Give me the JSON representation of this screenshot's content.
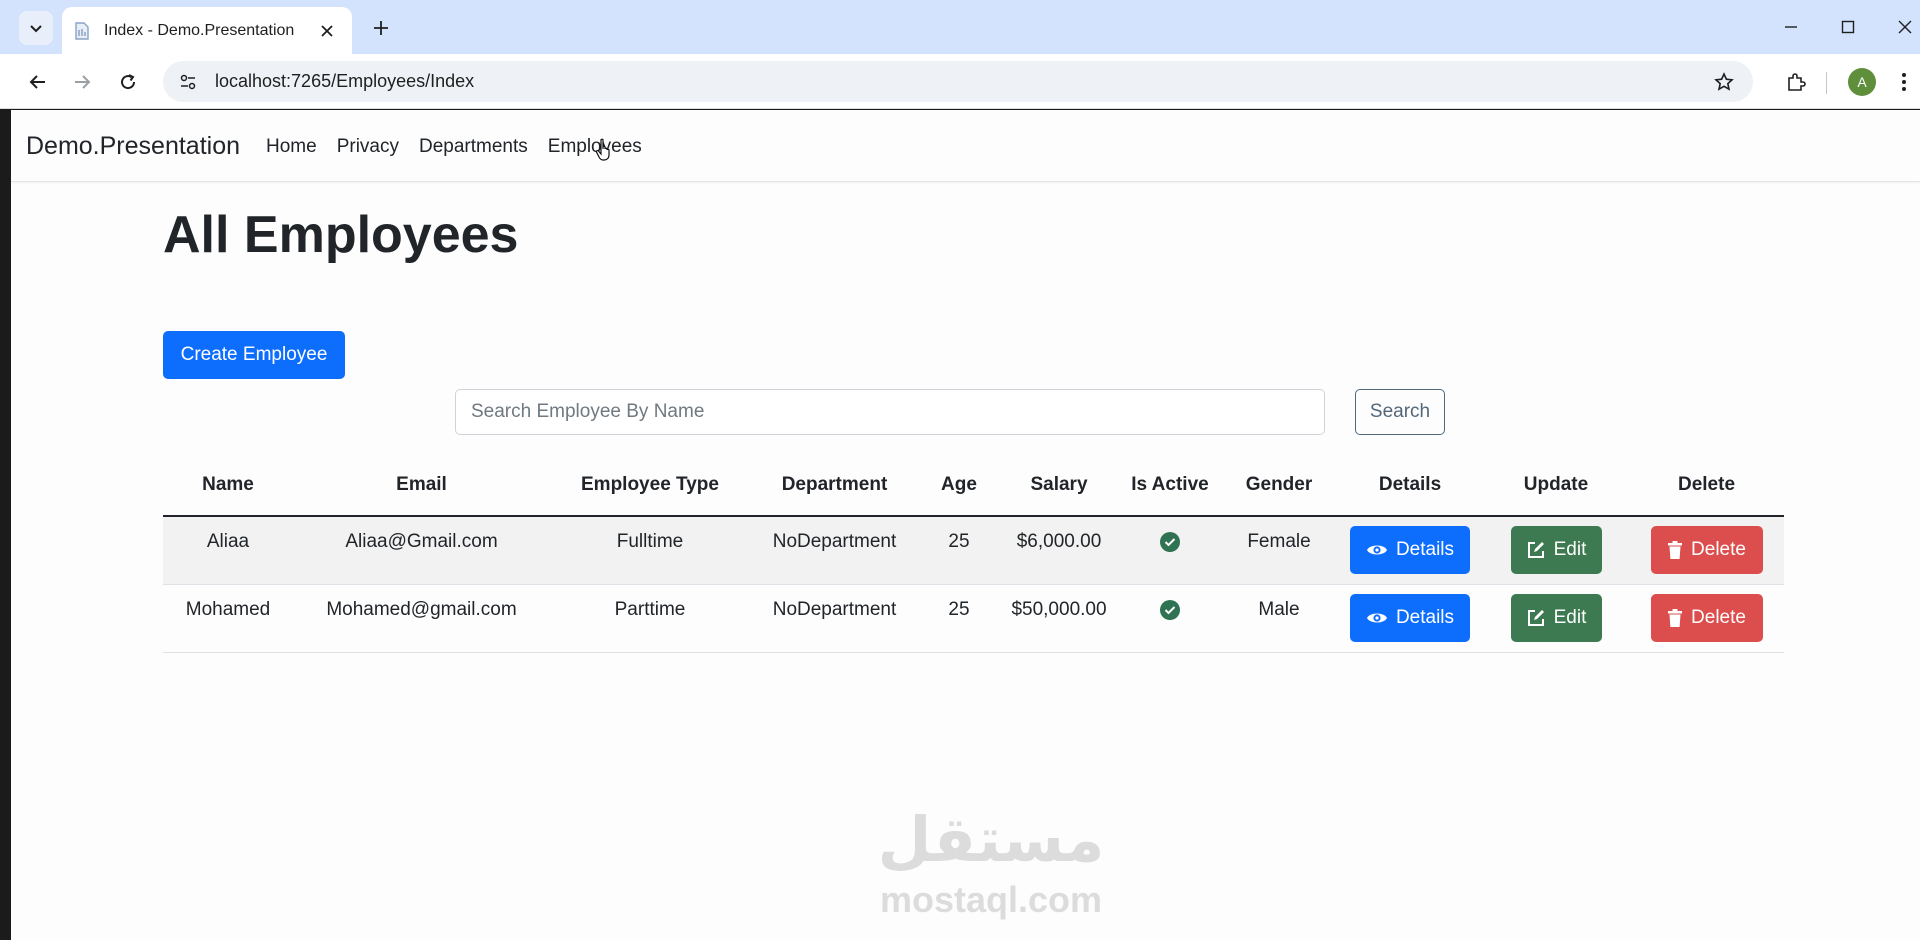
{
  "browser": {
    "tab_title": "Index - Demo.Presentation",
    "url": "localhost:7265/Employees/Index",
    "profile_initial": "A"
  },
  "navbar": {
    "brand": "Demo.Presentation",
    "links": [
      "Home",
      "Privacy",
      "Departments",
      "Employees"
    ]
  },
  "page": {
    "title": "All Employees",
    "create_label": "Create Employee",
    "search_placeholder": "Search Employee By Name",
    "search_label": "Search"
  },
  "table": {
    "headers": [
      "Name",
      "Email",
      "Employee Type",
      "Department",
      "Age",
      "Salary",
      "Is Active",
      "Gender",
      "Details",
      "Update",
      "Delete"
    ],
    "rows": [
      {
        "name": "Aliaa",
        "email": "Aliaa@Gmail.com",
        "type": "Fulltime",
        "department": "NoDepartment",
        "age": "25",
        "salary": "$6,000.00",
        "active": true,
        "gender": "Female"
      },
      {
        "name": "Mohamed",
        "email": "Mohamed@gmail.com",
        "type": "Parttime",
        "department": "NoDepartment",
        "age": "25",
        "salary": "$50,000.00",
        "active": true,
        "gender": "Male"
      }
    ],
    "details_label": "Details",
    "edit_label": "Edit",
    "delete_label": "Delete"
  },
  "watermark": {
    "arabic": "مستقل",
    "latin": "mostaql.com"
  },
  "colors": {
    "primary": "#0d6efd",
    "success": "#3d7a52",
    "danger": "#dc4e4e",
    "tabstrip": "#d3e3fd"
  }
}
